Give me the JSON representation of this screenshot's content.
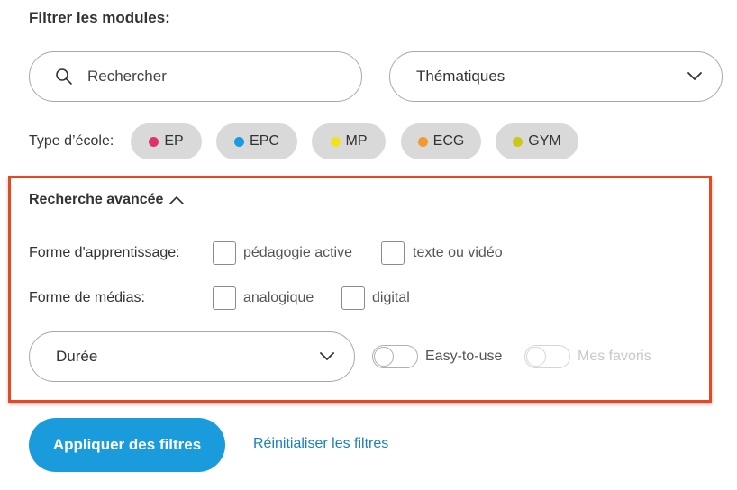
{
  "filter_title": "Filtrer les modules:",
  "search": {
    "placeholder": "Rechercher",
    "icon": "search-icon"
  },
  "thematiques": {
    "label": "Thématiques",
    "icon": "chevron-down-icon"
  },
  "school_type": {
    "label": "Type d’école:",
    "chips": [
      {
        "label": "EP",
        "color": "#e0306a"
      },
      {
        "label": "EPC",
        "color": "#1a9be0"
      },
      {
        "label": "MP",
        "color": "#f2e21a"
      },
      {
        "label": "ECG",
        "color": "#f19a30"
      },
      {
        "label": "GYM",
        "color": "#c9c91a"
      }
    ]
  },
  "advanced": {
    "title": "Recherche avancée",
    "icon": "chevron-up-icon",
    "learning_form": {
      "label": "Forme d'apprentissage:",
      "options": [
        "pédagogie active",
        "texte ou vidéo"
      ]
    },
    "media_form": {
      "label": "Forme de médias:",
      "options": [
        "analogique",
        "digital"
      ]
    },
    "duree": {
      "label": "Durée",
      "icon": "chevron-down-icon"
    },
    "easy_to_use": {
      "label": "Easy-to-use"
    },
    "favoris": {
      "label": "Mes favoris"
    }
  },
  "actions": {
    "apply": "Appliquer des filtres",
    "reset": "Réinitialiser les filtres"
  },
  "colors": {
    "accent": "#1a9bdb",
    "highlight_border": "#e8471f",
    "chip_bg": "#d9d9d9",
    "link": "#1a7fc0"
  }
}
